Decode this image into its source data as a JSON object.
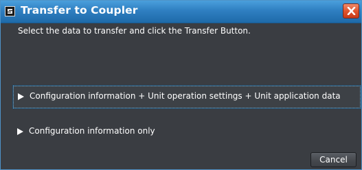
{
  "window": {
    "title": "Transfer to Coupler",
    "icon": "app-window-icon",
    "close_icon": "close-icon"
  },
  "dialog": {
    "instruction": "Select the data to transfer and click the Transfer Button.",
    "options": [
      {
        "label": "Configuration information + Unit operation settings + Unit application data",
        "icon": "play-arrow-icon",
        "focused": true
      },
      {
        "label": "Configuration information only",
        "icon": "play-arrow-icon",
        "focused": false
      }
    ],
    "cancel_label": "Cancel"
  },
  "colors": {
    "titlebar": "#2f7fc1",
    "background": "#3a3d42",
    "close_button": "#e0552e",
    "focus_border": "#6fb3e0"
  }
}
